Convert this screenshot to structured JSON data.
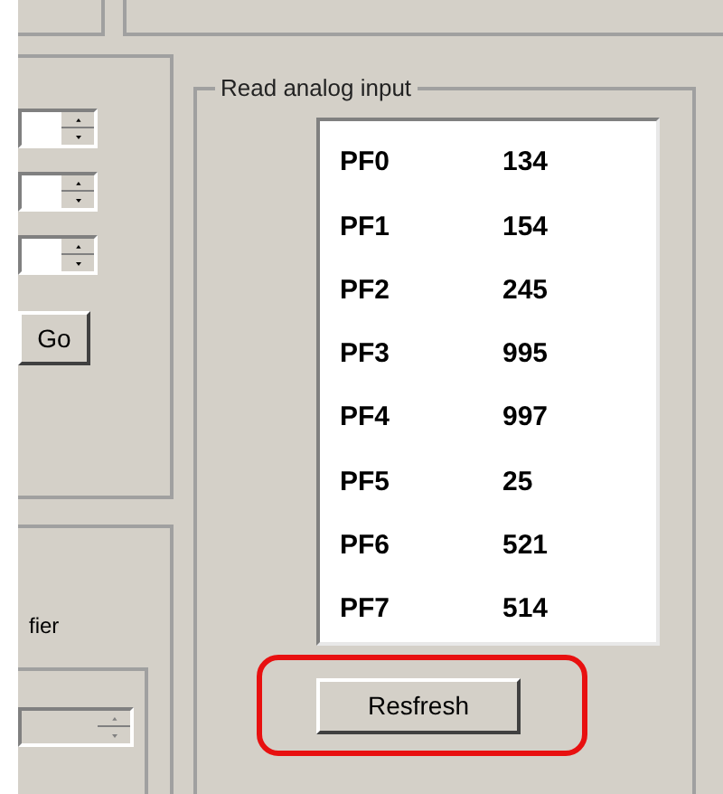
{
  "upper_left_panel": {
    "spin_fields": [
      {
        "disabled": false
      },
      {
        "disabled": false
      },
      {
        "disabled": false
      }
    ],
    "go_button": "Go"
  },
  "lower_left_panel": {
    "label": "fier",
    "spin_field": {
      "disabled": true
    }
  },
  "analog_group": {
    "title": "Read analog input",
    "readings": [
      {
        "pin": "PF0",
        "value": "134"
      },
      {
        "pin": "PF1",
        "value": "154"
      },
      {
        "pin": "PF2",
        "value": "245"
      },
      {
        "pin": "PF3",
        "value": "995"
      },
      {
        "pin": "PF4",
        "value": "997"
      },
      {
        "pin": "PF5",
        "value": "25"
      },
      {
        "pin": "PF6",
        "value": "521"
      },
      {
        "pin": "PF7",
        "value": "514"
      }
    ],
    "refresh_button": "Resfresh",
    "refresh_highlighted": true
  }
}
